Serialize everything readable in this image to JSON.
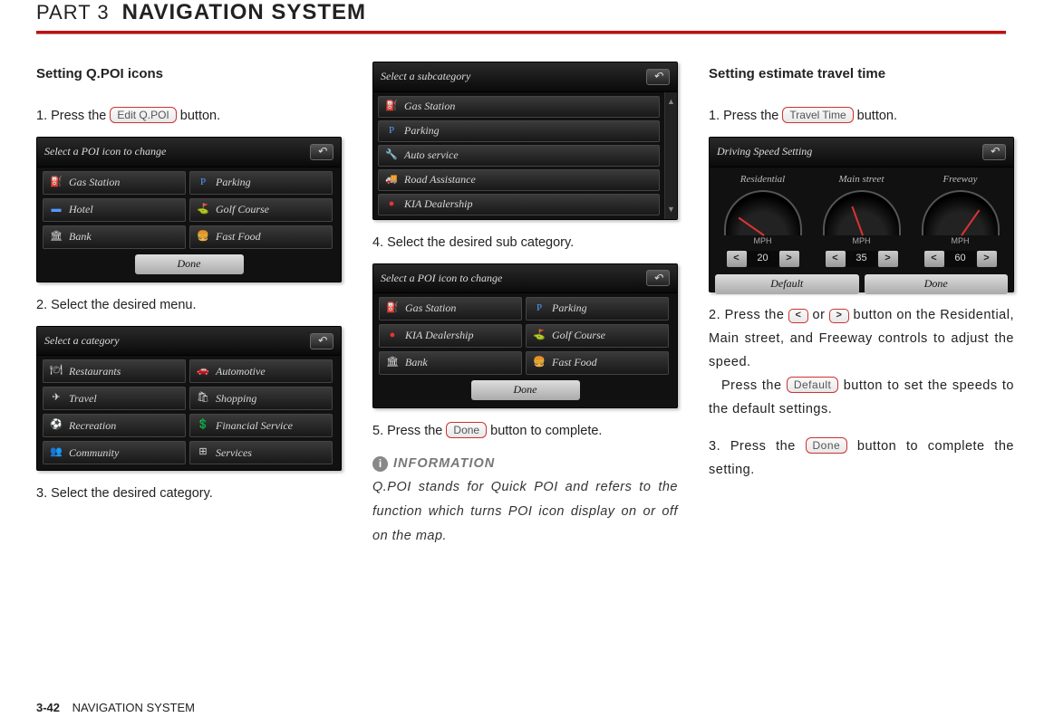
{
  "header": {
    "part": "PART 3",
    "title": "NAVIGATION SYSTEM"
  },
  "footer": {
    "page": "3-42",
    "label": "NAVIGATION SYSTEM"
  },
  "col1": {
    "h": "Setting Q.POI icons",
    "s1a": "1. Press the ",
    "s1btn": "Edit Q.POI",
    "s1b": " button.",
    "shot1": {
      "title": "Select a POI icon to change",
      "cells": [
        {
          "icon": "⛽",
          "cls": "ico-red",
          "t": "Gas Station"
        },
        {
          "icon": "P",
          "cls": "ico-blue",
          "t": "Parking"
        },
        {
          "icon": "▬",
          "cls": "ico-blue",
          "t": "Hotel"
        },
        {
          "icon": "⛳",
          "cls": "ico-yellow",
          "t": "Golf Course"
        },
        {
          "icon": "🏛",
          "cls": "ico-white",
          "t": "Bank"
        },
        {
          "icon": "🍔",
          "cls": "ico-orange",
          "t": "Fast Food"
        }
      ],
      "done": "Done"
    },
    "s2": "2. Select the desired menu.",
    "shot2": {
      "title": "Select a category",
      "cells": [
        {
          "icon": "🍽",
          "cls": "ico-white",
          "t": "Restaurants"
        },
        {
          "icon": "🚗",
          "cls": "ico-red",
          "t": "Automotive"
        },
        {
          "icon": "✈",
          "cls": "ico-white",
          "t": "Travel"
        },
        {
          "icon": "🛍",
          "cls": "ico-white",
          "t": "Shopping"
        },
        {
          "icon": "⚽",
          "cls": "ico-white",
          "t": "Recreation"
        },
        {
          "icon": "💲",
          "cls": "ico-green",
          "t": "Financial Service"
        },
        {
          "icon": "👥",
          "cls": "ico-white",
          "t": "Community"
        },
        {
          "icon": "⊞",
          "cls": "ico-white",
          "t": "Services"
        }
      ]
    },
    "s3": "3. Select the desired category."
  },
  "col2": {
    "shot3": {
      "title": "Select a subcategory",
      "rows": [
        {
          "icon": "⛽",
          "cls": "ico-red",
          "t": "Gas Station"
        },
        {
          "icon": "P",
          "cls": "ico-blue",
          "t": "Parking"
        },
        {
          "icon": "🔧",
          "cls": "ico-white",
          "t": "Auto service"
        },
        {
          "icon": "🚚",
          "cls": "ico-white",
          "t": "Road Assistance"
        },
        {
          "icon": "●",
          "cls": "ico-red",
          "t": "KIA Dealership"
        }
      ]
    },
    "s4": "4. Select the desired sub category.",
    "shot4": {
      "title": "Select a POI icon to change",
      "cells": [
        {
          "icon": "⛽",
          "cls": "ico-red",
          "t": "Gas Station"
        },
        {
          "icon": "P",
          "cls": "ico-blue",
          "t": "Parking"
        },
        {
          "icon": "●",
          "cls": "ico-red",
          "t": "KIA Dealership"
        },
        {
          "icon": "⛳",
          "cls": "ico-yellow",
          "t": "Golf Course"
        },
        {
          "icon": "🏛",
          "cls": "ico-white",
          "t": "Bank"
        },
        {
          "icon": "🍔",
          "cls": "ico-orange",
          "t": "Fast Food"
        }
      ],
      "done": "Done"
    },
    "s5a": "5. Press the  ",
    "s5btn": "Done",
    "s5b": " button to complete.",
    "infoTitle": "INFORMATION",
    "infoBody": "Q.POI stands for Quick POI and refers to the function which turns POI icon display on or off on the map."
  },
  "col3": {
    "h": "Setting estimate travel time",
    "s1a": "1. Press the ",
    "s1btn": "Travel Time",
    "s1b": " button.",
    "shot": {
      "title": "Driving Speed Setting",
      "labels": [
        "Residential",
        "Main street",
        "Freeway"
      ],
      "mph": "MPH",
      "vals": [
        "20",
        "35",
        "60"
      ],
      "btns": [
        "Default",
        "Done"
      ]
    },
    "s2a": "2. Press the ",
    "s2mid": " or ",
    "s2b": " button on the Residential, Main street, and Freeway controls to adjust the speed.",
    "s2c": "Press the ",
    "s2btn": "Default",
    "s2d": " button to set the speeds to the default settings.",
    "s3a": "3. Press the ",
    "s3btn": "Done",
    "s3b": " button to complete the setting."
  }
}
